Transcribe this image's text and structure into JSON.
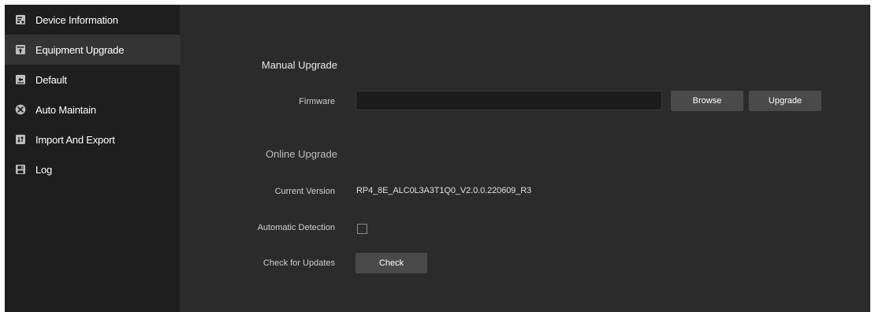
{
  "sidebar": {
    "items": [
      {
        "label": "Device Information",
        "icon": "device-info-icon"
      },
      {
        "label": "Equipment Upgrade",
        "icon": "upgrade-icon",
        "active": true
      },
      {
        "label": "Default",
        "icon": "default-icon"
      },
      {
        "label": "Auto Maintain",
        "icon": "maintain-icon"
      },
      {
        "label": "Import And Export",
        "icon": "import-export-icon"
      },
      {
        "label": "Log",
        "icon": "log-icon"
      }
    ]
  },
  "manual": {
    "title": "Manual Upgrade",
    "firmware_label": "Firmware",
    "firmware_value": "",
    "browse_label": "Browse",
    "upgrade_label": "Upgrade"
  },
  "online": {
    "title": "Online Upgrade",
    "current_version_label": "Current Version",
    "current_version_value": "RP4_8E_ALC0L3A3T1Q0_V2.0.0.220609_R3",
    "auto_detection_label": "Automatic Detection",
    "auto_detection_checked": false,
    "check_updates_label": "Check for Updates",
    "check_label": "Check"
  },
  "colors": {
    "sidebar_bg": "#1e1e1e",
    "active_bg": "#343434",
    "main_bg": "#2b2b2b",
    "button_bg": "#4a4a4a"
  }
}
